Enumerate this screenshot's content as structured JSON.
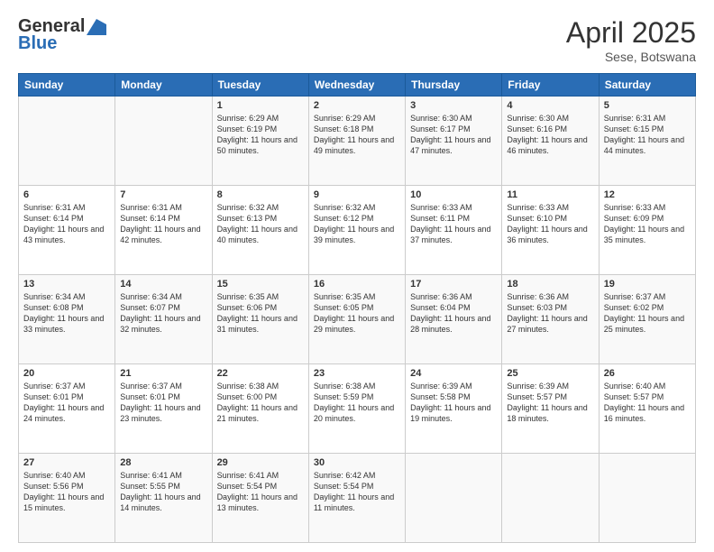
{
  "header": {
    "logo_general": "General",
    "logo_blue": "Blue",
    "month_title": "April 2025",
    "location": "Sese, Botswana"
  },
  "weekdays": [
    "Sunday",
    "Monday",
    "Tuesday",
    "Wednesday",
    "Thursday",
    "Friday",
    "Saturday"
  ],
  "weeks": [
    [
      {
        "day": "",
        "sunrise": "",
        "sunset": "",
        "daylight": ""
      },
      {
        "day": "",
        "sunrise": "",
        "sunset": "",
        "daylight": ""
      },
      {
        "day": "1",
        "sunrise": "Sunrise: 6:29 AM",
        "sunset": "Sunset: 6:19 PM",
        "daylight": "Daylight: 11 hours and 50 minutes."
      },
      {
        "day": "2",
        "sunrise": "Sunrise: 6:29 AM",
        "sunset": "Sunset: 6:18 PM",
        "daylight": "Daylight: 11 hours and 49 minutes."
      },
      {
        "day": "3",
        "sunrise": "Sunrise: 6:30 AM",
        "sunset": "Sunset: 6:17 PM",
        "daylight": "Daylight: 11 hours and 47 minutes."
      },
      {
        "day": "4",
        "sunrise": "Sunrise: 6:30 AM",
        "sunset": "Sunset: 6:16 PM",
        "daylight": "Daylight: 11 hours and 46 minutes."
      },
      {
        "day": "5",
        "sunrise": "Sunrise: 6:31 AM",
        "sunset": "Sunset: 6:15 PM",
        "daylight": "Daylight: 11 hours and 44 minutes."
      }
    ],
    [
      {
        "day": "6",
        "sunrise": "Sunrise: 6:31 AM",
        "sunset": "Sunset: 6:14 PM",
        "daylight": "Daylight: 11 hours and 43 minutes."
      },
      {
        "day": "7",
        "sunrise": "Sunrise: 6:31 AM",
        "sunset": "Sunset: 6:14 PM",
        "daylight": "Daylight: 11 hours and 42 minutes."
      },
      {
        "day": "8",
        "sunrise": "Sunrise: 6:32 AM",
        "sunset": "Sunset: 6:13 PM",
        "daylight": "Daylight: 11 hours and 40 minutes."
      },
      {
        "day": "9",
        "sunrise": "Sunrise: 6:32 AM",
        "sunset": "Sunset: 6:12 PM",
        "daylight": "Daylight: 11 hours and 39 minutes."
      },
      {
        "day": "10",
        "sunrise": "Sunrise: 6:33 AM",
        "sunset": "Sunset: 6:11 PM",
        "daylight": "Daylight: 11 hours and 37 minutes."
      },
      {
        "day": "11",
        "sunrise": "Sunrise: 6:33 AM",
        "sunset": "Sunset: 6:10 PM",
        "daylight": "Daylight: 11 hours and 36 minutes."
      },
      {
        "day": "12",
        "sunrise": "Sunrise: 6:33 AM",
        "sunset": "Sunset: 6:09 PM",
        "daylight": "Daylight: 11 hours and 35 minutes."
      }
    ],
    [
      {
        "day": "13",
        "sunrise": "Sunrise: 6:34 AM",
        "sunset": "Sunset: 6:08 PM",
        "daylight": "Daylight: 11 hours and 33 minutes."
      },
      {
        "day": "14",
        "sunrise": "Sunrise: 6:34 AM",
        "sunset": "Sunset: 6:07 PM",
        "daylight": "Daylight: 11 hours and 32 minutes."
      },
      {
        "day": "15",
        "sunrise": "Sunrise: 6:35 AM",
        "sunset": "Sunset: 6:06 PM",
        "daylight": "Daylight: 11 hours and 31 minutes."
      },
      {
        "day": "16",
        "sunrise": "Sunrise: 6:35 AM",
        "sunset": "Sunset: 6:05 PM",
        "daylight": "Daylight: 11 hours and 29 minutes."
      },
      {
        "day": "17",
        "sunrise": "Sunrise: 6:36 AM",
        "sunset": "Sunset: 6:04 PM",
        "daylight": "Daylight: 11 hours and 28 minutes."
      },
      {
        "day": "18",
        "sunrise": "Sunrise: 6:36 AM",
        "sunset": "Sunset: 6:03 PM",
        "daylight": "Daylight: 11 hours and 27 minutes."
      },
      {
        "day": "19",
        "sunrise": "Sunrise: 6:37 AM",
        "sunset": "Sunset: 6:02 PM",
        "daylight": "Daylight: 11 hours and 25 minutes."
      }
    ],
    [
      {
        "day": "20",
        "sunrise": "Sunrise: 6:37 AM",
        "sunset": "Sunset: 6:01 PM",
        "daylight": "Daylight: 11 hours and 24 minutes."
      },
      {
        "day": "21",
        "sunrise": "Sunrise: 6:37 AM",
        "sunset": "Sunset: 6:01 PM",
        "daylight": "Daylight: 11 hours and 23 minutes."
      },
      {
        "day": "22",
        "sunrise": "Sunrise: 6:38 AM",
        "sunset": "Sunset: 6:00 PM",
        "daylight": "Daylight: 11 hours and 21 minutes."
      },
      {
        "day": "23",
        "sunrise": "Sunrise: 6:38 AM",
        "sunset": "Sunset: 5:59 PM",
        "daylight": "Daylight: 11 hours and 20 minutes."
      },
      {
        "day": "24",
        "sunrise": "Sunrise: 6:39 AM",
        "sunset": "Sunset: 5:58 PM",
        "daylight": "Daylight: 11 hours and 19 minutes."
      },
      {
        "day": "25",
        "sunrise": "Sunrise: 6:39 AM",
        "sunset": "Sunset: 5:57 PM",
        "daylight": "Daylight: 11 hours and 18 minutes."
      },
      {
        "day": "26",
        "sunrise": "Sunrise: 6:40 AM",
        "sunset": "Sunset: 5:57 PM",
        "daylight": "Daylight: 11 hours and 16 minutes."
      }
    ],
    [
      {
        "day": "27",
        "sunrise": "Sunrise: 6:40 AM",
        "sunset": "Sunset: 5:56 PM",
        "daylight": "Daylight: 11 hours and 15 minutes."
      },
      {
        "day": "28",
        "sunrise": "Sunrise: 6:41 AM",
        "sunset": "Sunset: 5:55 PM",
        "daylight": "Daylight: 11 hours and 14 minutes."
      },
      {
        "day": "29",
        "sunrise": "Sunrise: 6:41 AM",
        "sunset": "Sunset: 5:54 PM",
        "daylight": "Daylight: 11 hours and 13 minutes."
      },
      {
        "day": "30",
        "sunrise": "Sunrise: 6:42 AM",
        "sunset": "Sunset: 5:54 PM",
        "daylight": "Daylight: 11 hours and 11 minutes."
      },
      {
        "day": "",
        "sunrise": "",
        "sunset": "",
        "daylight": ""
      },
      {
        "day": "",
        "sunrise": "",
        "sunset": "",
        "daylight": ""
      },
      {
        "day": "",
        "sunrise": "",
        "sunset": "",
        "daylight": ""
      }
    ]
  ]
}
